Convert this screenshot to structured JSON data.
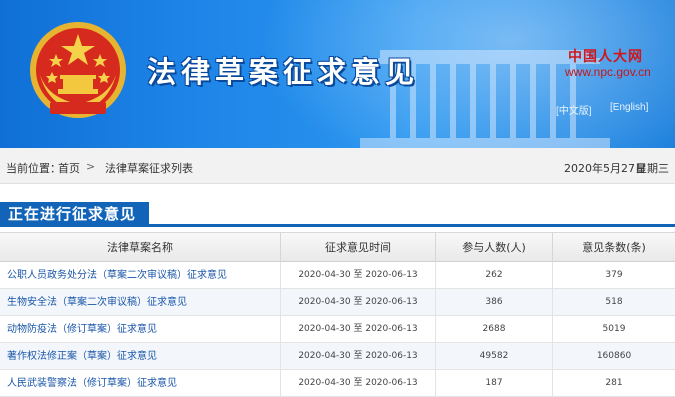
{
  "header": {
    "title": "法律草案征求意见",
    "logo_cn": "中国人大网",
    "logo_url": "www.npc.gov.cn",
    "lang_cn": "[中文版]",
    "lang_en": "[English]"
  },
  "breadcrumb": {
    "label": "当前位置：",
    "home": "首页",
    "separator": ">",
    "current": "法律草案征求列表",
    "date": "2020年5月27日",
    "weekday": "星期三"
  },
  "section": {
    "title": "正在进行征求意见"
  },
  "table": {
    "headers": [
      "法律草案名称",
      "征求意见时间",
      "参与人数(人)",
      "意见条数(条)"
    ],
    "rows": [
      {
        "name": "公职人员政务处分法（草案二次审议稿）征求意见",
        "period": "2020-04-30 至 2020-06-13",
        "participants": "262",
        "opinions": "379"
      },
      {
        "name": "生物安全法（草案二次审议稿）征求意见",
        "period": "2020-04-30 至 2020-06-13",
        "participants": "386",
        "opinions": "518"
      },
      {
        "name": "动物防疫法（修订草案）征求意见",
        "period": "2020-04-30 至 2020-06-13",
        "participants": "2688",
        "opinions": "5019"
      },
      {
        "name": "著作权法修正案（草案）征求意见",
        "period": "2020-04-30 至 2020-06-13",
        "participants": "49582",
        "opinions": "160860"
      },
      {
        "name": "人民武装警察法（修订草案）征求意见",
        "period": "2020-04-30 至 2020-06-13",
        "participants": "187",
        "opinions": "281"
      }
    ]
  },
  "colors": {
    "banner": "#1f86e8",
    "section": "#1264b8",
    "link": "#1a56a8",
    "logo_red": "#d0161b"
  }
}
